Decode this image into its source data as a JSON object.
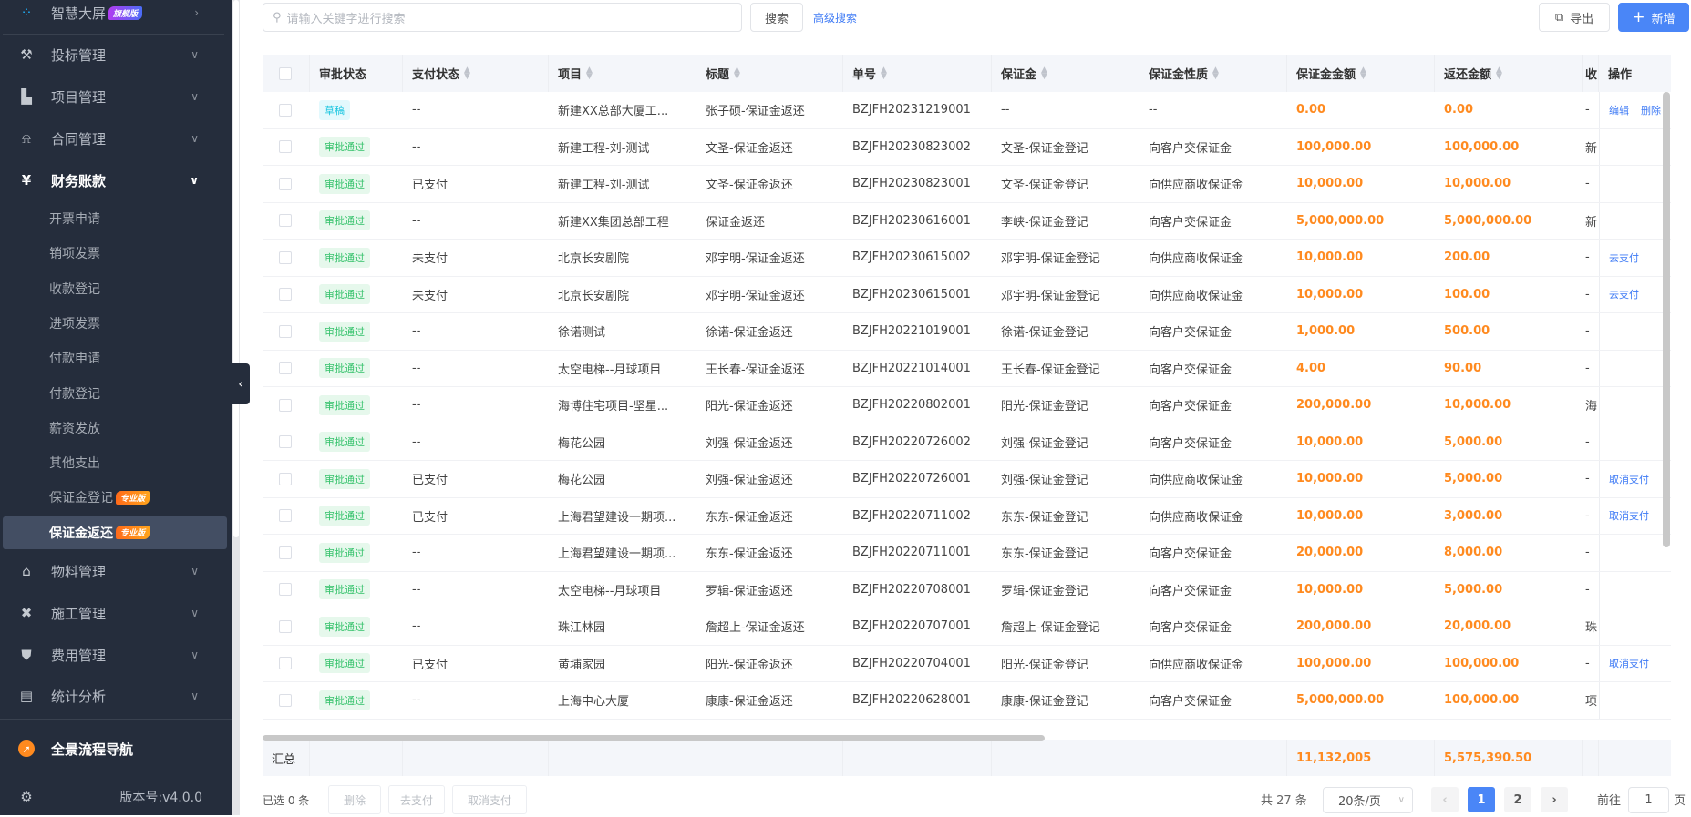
{
  "sidebar": {
    "top": {
      "label": "智慧大屏",
      "badge": "旗舰版"
    },
    "menus": [
      {
        "label": "投标管理",
        "icon": "gavel-icon"
      },
      {
        "label": "项目管理",
        "icon": "building-icon"
      },
      {
        "label": "合同管理",
        "icon": "stamp-icon"
      },
      {
        "label": "财务账款",
        "icon": "money-bag-icon"
      }
    ],
    "finance_items": [
      {
        "label": "开票申请"
      },
      {
        "label": "销项发票"
      },
      {
        "label": "收款登记"
      },
      {
        "label": "进项发票"
      },
      {
        "label": "付款申请"
      },
      {
        "label": "付款登记"
      },
      {
        "label": "薪资发放"
      },
      {
        "label": "其他支出"
      },
      {
        "label": "保证金登记",
        "badge": "专业版"
      },
      {
        "label": "保证金返还",
        "badge": "专业版"
      }
    ],
    "menus2": [
      {
        "label": "物料管理",
        "icon": "warehouse-icon"
      },
      {
        "label": "施工管理",
        "icon": "tools-icon"
      },
      {
        "label": "费用管理",
        "icon": "shield-yen-icon"
      },
      {
        "label": "统计分析",
        "icon": "chart-box-icon"
      }
    ],
    "nav_flow": "全景流程导航",
    "version": "版本号:v4.0.0"
  },
  "toolbar": {
    "search_placeholder": "请输入关键字进行搜索",
    "search": "搜索",
    "advanced": "高级搜索",
    "export": "导出",
    "add": "新增"
  },
  "table": {
    "headers": [
      "审批状态",
      "支付状态",
      "项目",
      "标题",
      "单号",
      "保证金",
      "保证金性质",
      "保证金金额",
      "返还金额",
      "收",
      "操作"
    ],
    "rows": [
      {
        "status": "草稿",
        "pay": "--",
        "project": "新建XX总部大厦工...",
        "title": "张子硕-保证金返还",
        "no": "BZJFH20231219001",
        "deposit": "--",
        "nature": "--",
        "amount": "0.00",
        "returned": "0.00",
        "trunc": "-",
        "ops": [
          "编辑",
          "删除"
        ]
      },
      {
        "status": "审批通过",
        "pay": "--",
        "project": "新建工程-刘-测试",
        "title": "文圣-保证金返还",
        "no": "BZJFH20230823002",
        "deposit": "文圣-保证金登记",
        "nature": "向客户交保证金",
        "amount": "100,000.00",
        "returned": "100,000.00",
        "trunc": "新",
        "ops": []
      },
      {
        "status": "审批通过",
        "pay": "已支付",
        "project": "新建工程-刘-测试",
        "title": "文圣-保证金返还",
        "no": "BZJFH20230823001",
        "deposit": "文圣-保证金登记",
        "nature": "向供应商收保证金",
        "amount": "10,000.00",
        "returned": "10,000.00",
        "trunc": "-",
        "ops": []
      },
      {
        "status": "审批通过",
        "pay": "--",
        "project": "新建XX集团总部工程",
        "title": "保证金返还",
        "no": "BZJFH20230616001",
        "deposit": "李峡-保证金登记",
        "nature": "向客户交保证金",
        "amount": "5,000,000.00",
        "returned": "5,000,000.00",
        "trunc": "新",
        "ops": []
      },
      {
        "status": "审批通过",
        "pay": "未支付",
        "project": "北京长安剧院",
        "title": "邓宇明-保证金返还",
        "no": "BZJFH20230615002",
        "deposit": "邓宇明-保证金登记",
        "nature": "向供应商收保证金",
        "amount": "10,000.00",
        "returned": "200.00",
        "trunc": "-",
        "ops": [
          "去支付"
        ]
      },
      {
        "status": "审批通过",
        "pay": "未支付",
        "project": "北京长安剧院",
        "title": "邓宇明-保证金返还",
        "no": "BZJFH20230615001",
        "deposit": "邓宇明-保证金登记",
        "nature": "向供应商收保证金",
        "amount": "10,000.00",
        "returned": "100.00",
        "trunc": "-",
        "ops": [
          "去支付"
        ]
      },
      {
        "status": "审批通过",
        "pay": "--",
        "project": "徐诺测试",
        "title": "徐诺-保证金返还",
        "no": "BZJFH20221019001",
        "deposit": "徐诺-保证金登记",
        "nature": "向客户交保证金",
        "amount": "1,000.00",
        "returned": "500.00",
        "trunc": "-",
        "ops": []
      },
      {
        "status": "审批通过",
        "pay": "--",
        "project": "太空电梯--月球项目",
        "title": "王长春-保证金返还",
        "no": "BZJFH20221014001",
        "deposit": "王长春-保证金登记",
        "nature": "向客户交保证金",
        "amount": "4.00",
        "returned": "90.00",
        "trunc": "-",
        "ops": []
      },
      {
        "status": "审批通过",
        "pay": "--",
        "project": "海博住宅项目-坚星...",
        "title": "阳光-保证金返还",
        "no": "BZJFH20220802001",
        "deposit": "阳光-保证金登记",
        "nature": "向客户交保证金",
        "amount": "200,000.00",
        "returned": "10,000.00",
        "trunc": "海",
        "ops": []
      },
      {
        "status": "审批通过",
        "pay": "--",
        "project": "梅花公园",
        "title": "刘强-保证金返还",
        "no": "BZJFH20220726002",
        "deposit": "刘强-保证金登记",
        "nature": "向客户交保证金",
        "amount": "10,000.00",
        "returned": "5,000.00",
        "trunc": "-",
        "ops": []
      },
      {
        "status": "审批通过",
        "pay": "已支付",
        "project": "梅花公园",
        "title": "刘强-保证金返还",
        "no": "BZJFH20220726001",
        "deposit": "刘强-保证金登记",
        "nature": "向供应商收保证金",
        "amount": "10,000.00",
        "returned": "5,000.00",
        "trunc": "-",
        "ops": [
          "取消支付"
        ]
      },
      {
        "status": "审批通过",
        "pay": "已支付",
        "project": "上海君望建设一期项...",
        "title": "东东-保证金返还",
        "no": "BZJFH20220711002",
        "deposit": "东东-保证金登记",
        "nature": "向供应商收保证金",
        "amount": "10,000.00",
        "returned": "3,000.00",
        "trunc": "-",
        "ops": [
          "取消支付"
        ]
      },
      {
        "status": "审批通过",
        "pay": "--",
        "project": "上海君望建设一期项...",
        "title": "东东-保证金返还",
        "no": "BZJFH20220711001",
        "deposit": "东东-保证金登记",
        "nature": "向客户交保证金",
        "amount": "20,000.00",
        "returned": "8,000.00",
        "trunc": "-",
        "ops": []
      },
      {
        "status": "审批通过",
        "pay": "--",
        "project": "太空电梯--月球项目",
        "title": "罗辑-保证金返还",
        "no": "BZJFH20220708001",
        "deposit": "罗辑-保证金登记",
        "nature": "向客户交保证金",
        "amount": "10,000.00",
        "returned": "5,000.00",
        "trunc": "-",
        "ops": []
      },
      {
        "status": "审批通过",
        "pay": "--",
        "project": "珠江林园",
        "title": "詹超上-保证金返还",
        "no": "BZJFH20220707001",
        "deposit": "詹超上-保证金登记",
        "nature": "向客户交保证金",
        "amount": "200,000.00",
        "returned": "20,000.00",
        "trunc": "珠",
        "ops": []
      },
      {
        "status": "审批通过",
        "pay": "已支付",
        "project": "黄埔家园",
        "title": "阳光-保证金返还",
        "no": "BZJFH20220704001",
        "deposit": "阳光-保证金登记",
        "nature": "向供应商收保证金",
        "amount": "100,000.00",
        "returned": "100,000.00",
        "trunc": "-",
        "ops": [
          "取消支付"
        ]
      },
      {
        "status": "审批通过",
        "pay": "--",
        "project": "上海中心大厦",
        "title": "康康-保证金返还",
        "no": "BZJFH20220628001",
        "deposit": "康康-保证金登记",
        "nature": "向客户交保证金",
        "amount": "5,000,000.00",
        "returned": "100,000.00",
        "trunc": "项",
        "ops": []
      }
    ],
    "summary": {
      "label": "汇总",
      "amount": "11,132,005",
      "returned": "5,575,390.50"
    }
  },
  "footer": {
    "selected": "已选 0 条",
    "delete": "删除",
    "pay": "去支付",
    "cancel_pay": "取消支付",
    "total": "共 27 条",
    "page_size": "20条/页",
    "pages": [
      "1",
      "2"
    ],
    "current_page": "1",
    "goto": "前往",
    "goto_value": "1",
    "page_unit": "页"
  },
  "colors": {
    "sidebar": "#252d3c",
    "accent": "#3f7bf5",
    "amount": "#ff8a1f",
    "approved": "#35c26b",
    "draft": "#19c5e0"
  }
}
